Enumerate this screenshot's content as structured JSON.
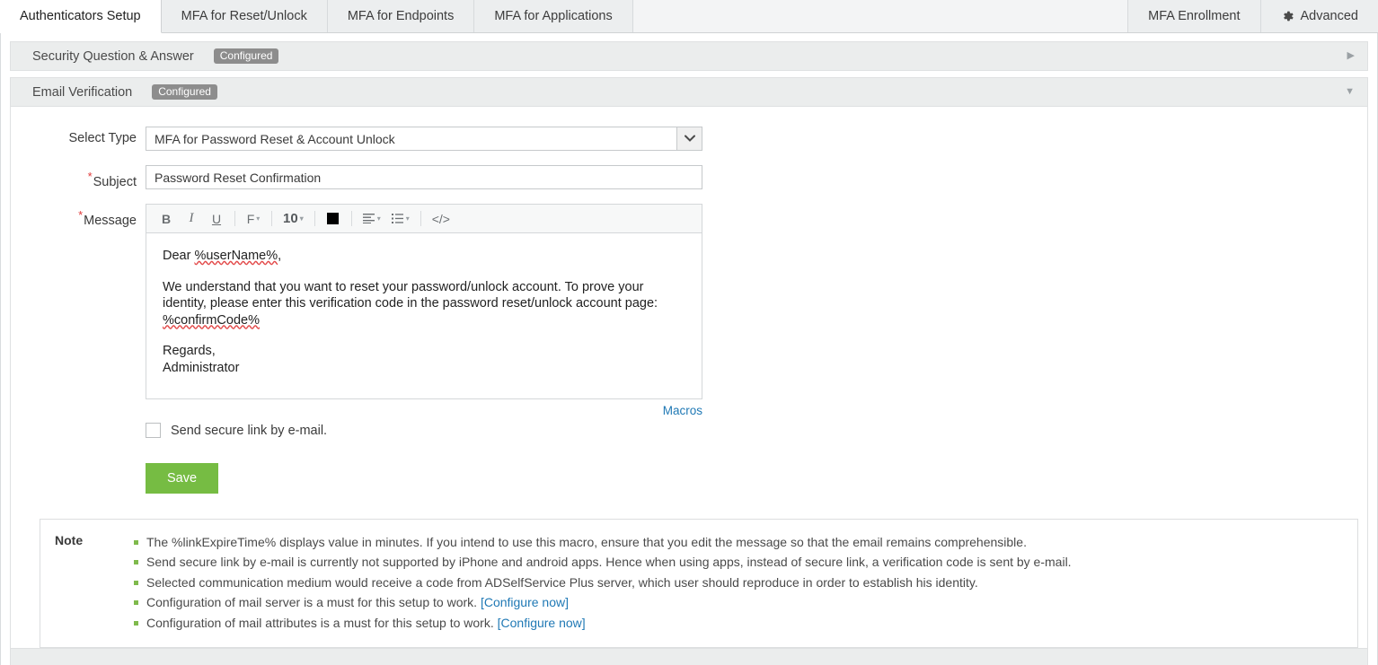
{
  "tabs": {
    "left": [
      {
        "label": "Authenticators Setup",
        "active": true
      },
      {
        "label": "MFA for Reset/Unlock",
        "active": false
      },
      {
        "label": "MFA for Endpoints",
        "active": false
      },
      {
        "label": "MFA for Applications",
        "active": false
      }
    ],
    "right": [
      {
        "label": "MFA Enrollment",
        "icon": ""
      },
      {
        "label": "Advanced",
        "icon": "gear-icon"
      }
    ]
  },
  "accordions": {
    "security_question": {
      "title": "Security Question & Answer",
      "badge": "Configured",
      "arrow": "▶",
      "expanded": false
    },
    "email_verification": {
      "title": "Email Verification",
      "badge": "Configured",
      "arrow": "▼",
      "expanded": true
    }
  },
  "form": {
    "select_type": {
      "label": "Select Type",
      "value": "MFA for Password Reset & Account Unlock",
      "chevron": "⌄"
    },
    "subject": {
      "label": "Subject",
      "required_marker": "*",
      "value": "Password Reset Confirmation"
    },
    "message": {
      "label": "Message",
      "required_marker": "*",
      "toolbar": {
        "bold": "B",
        "italic": "I",
        "underline": "U",
        "font": "F",
        "font_size": "10",
        "color_swatch": "#000000",
        "align": "align-left-icon",
        "list": "bullet-list-icon",
        "source": "</>"
      },
      "body": {
        "greeting_pre": "Dear ",
        "greeting_macro": "%userName%",
        "greeting_post": ",",
        "para_pre": "We understand that you want to reset your password/unlock account. To prove your identity, please enter this verification code in the password reset/unlock account page: ",
        "para_macro": "%confirmCode%",
        "sign_1": "Regards,",
        "sign_2": "Administrator"
      }
    },
    "macros_link": "Macros",
    "secure_link_checkbox": {
      "label": "Send secure link by e-mail.",
      "checked": false
    },
    "save_button": "Save"
  },
  "note": {
    "label": "Note",
    "items": [
      {
        "text": "The %linkExpireTime% displays value in minutes. If you intend to use this macro, ensure that you edit the message so that the email remains comprehensible.",
        "link": ""
      },
      {
        "text": "Send secure link by e-mail is currently not supported by iPhone and android apps. Hence when using apps, instead of secure link, a verification code is sent by e-mail.",
        "link": ""
      },
      {
        "text": "Selected communication medium would receive a code from ADSelfService Plus server, which user should reproduce in order to establish his identity.",
        "link": ""
      },
      {
        "text": "Configuration of mail server is a must for this setup to work.",
        "link": "[Configure now]"
      },
      {
        "text": "Configuration of mail attributes is a must for this setup to work.",
        "link": "[Configure now]"
      }
    ]
  },
  "colors": {
    "accent_green": "#76bc43",
    "link_blue": "#2079b5",
    "badge_gray": "#8d8d8d",
    "required_red": "#e03a3a",
    "bullet_green": "#7fba4c"
  }
}
